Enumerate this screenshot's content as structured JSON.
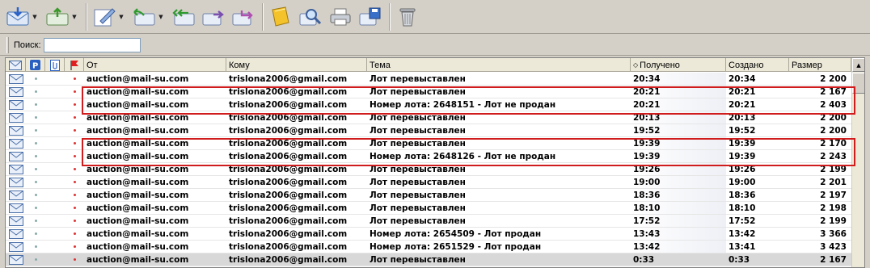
{
  "toolbar": {
    "buttons": [
      {
        "name": "receive-mail-icon"
      },
      {
        "name": "send-mail-icon"
      },
      {
        "name": "compose-icon"
      },
      {
        "name": "reply-icon"
      },
      {
        "name": "reply-all-icon"
      },
      {
        "name": "forward-icon"
      },
      {
        "name": "redirect-icon"
      },
      {
        "name": "address-book-icon"
      },
      {
        "name": "find-icon"
      },
      {
        "name": "print-icon"
      },
      {
        "name": "save-icon"
      },
      {
        "name": "trash-icon"
      }
    ]
  },
  "search": {
    "label": "Поиск:",
    "value": ""
  },
  "columns": {
    "from": "От",
    "to": "Кому",
    "subject": "Тема",
    "received": "Получено",
    "created": "Создано",
    "size": "Размер"
  },
  "messages": [
    {
      "from": "auction@mail-su.com",
      "to": "trislona2006@gmail.com",
      "subject": "Лот перевыставлен",
      "received": "20:34",
      "created": "20:34",
      "size": "2 200"
    },
    {
      "from": "auction@mail-su.com",
      "to": "trislona2006@gmail.com",
      "subject": "Лот перевыставлен",
      "received": "20:21",
      "created": "20:21",
      "size": "2 167"
    },
    {
      "from": "auction@mail-su.com",
      "to": "trislona2006@gmail.com",
      "subject": "Номер лота: 2648151 - Лот не продан",
      "received": "20:21",
      "created": "20:21",
      "size": "2 403"
    },
    {
      "from": "auction@mail-su.com",
      "to": "trislona2006@gmail.com",
      "subject": "Лот перевыставлен",
      "received": "20:13",
      "created": "20:13",
      "size": "2 200"
    },
    {
      "from": "auction@mail-su.com",
      "to": "trislona2006@gmail.com",
      "subject": "Лот перевыставлен",
      "received": "19:52",
      "created": "19:52",
      "size": "2 200"
    },
    {
      "from": "auction@mail-su.com",
      "to": "trislona2006@gmail.com",
      "subject": "Лот перевыставлен",
      "received": "19:39",
      "created": "19:39",
      "size": "2 170"
    },
    {
      "from": "auction@mail-su.com",
      "to": "trislona2006@gmail.com",
      "subject": "Номер лота: 2648126 - Лот не продан",
      "received": "19:39",
      "created": "19:39",
      "size": "2 243"
    },
    {
      "from": "auction@mail-su.com",
      "to": "trislona2006@gmail.com",
      "subject": "Лот перевыставлен",
      "received": "19:26",
      "created": "19:26",
      "size": "2 199"
    },
    {
      "from": "auction@mail-su.com",
      "to": "trislona2006@gmail.com",
      "subject": "Лот перевыставлен",
      "received": "19:00",
      "created": "19:00",
      "size": "2 201"
    },
    {
      "from": "auction@mail-su.com",
      "to": "trislona2006@gmail.com",
      "subject": "Лот перевыставлен",
      "received": "18:36",
      "created": "18:36",
      "size": "2 197"
    },
    {
      "from": "auction@mail-su.com",
      "to": "trislona2006@gmail.com",
      "subject": "Лот перевыставлен",
      "received": "18:10",
      "created": "18:10",
      "size": "2 198"
    },
    {
      "from": "auction@mail-su.com",
      "to": "trislona2006@gmail.com",
      "subject": "Лот перевыставлен",
      "received": "17:52",
      "created": "17:52",
      "size": "2 199"
    },
    {
      "from": "auction@mail-su.com",
      "to": "trislona2006@gmail.com",
      "subject": "Номер лота: 2654509 - Лот продан",
      "received": "13:43",
      "created": "13:42",
      "size": "3 366"
    },
    {
      "from": "auction@mail-su.com",
      "to": "trislona2006@gmail.com",
      "subject": "Номер лота: 2651529 - Лот продан",
      "received": "13:42",
      "created": "13:41",
      "size": "3 423"
    },
    {
      "from": "auction@mail-su.com",
      "to": "trislona2006@gmail.com",
      "subject": "Лот перевыставлен",
      "received": "0:33",
      "created": "0:33",
      "size": "2 167"
    }
  ],
  "highlight_color": "#d01c1c"
}
